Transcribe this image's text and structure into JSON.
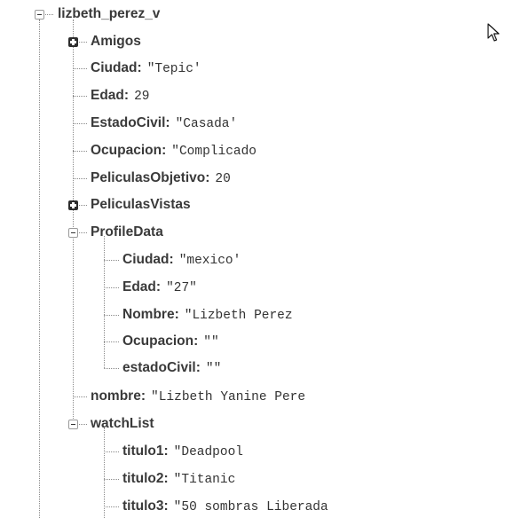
{
  "tree": {
    "root": {
      "key": "lizbeth_perez_v"
    },
    "amigos": {
      "key": "Amigos"
    },
    "ciudad": {
      "key": "Ciudad",
      "value": "\"Tepic'"
    },
    "edad": {
      "key": "Edad",
      "value": "29"
    },
    "estado_civil": {
      "key": "EstadoCivil",
      "value": "\"Casada'"
    },
    "ocupacion": {
      "key": "Ocupacion",
      "value": "\"Complicado"
    },
    "peliculas_objetivo": {
      "key": "PeliculasObjetivo",
      "value": "20"
    },
    "peliculas_vistas": {
      "key": "PeliculasVistas"
    },
    "profile_data": {
      "key": "ProfileData",
      "ciudad": {
        "key": "Ciudad",
        "value": "\"mexico'"
      },
      "edad": {
        "key": "Edad",
        "value": "\"27\""
      },
      "nombre": {
        "key": "Nombre",
        "value": "\"Lizbeth Perez"
      },
      "ocupacion": {
        "key": "Ocupacion",
        "value": "\"\""
      },
      "estado_civil": {
        "key": "estadoCivil",
        "value": "\"\""
      }
    },
    "nombre": {
      "key": "nombre",
      "value": "\"Lizbeth Yanine Pere"
    },
    "watch_list": {
      "key": "watchList",
      "titulo1": {
        "key": "titulo1",
        "value": "\"Deadpool"
      },
      "titulo2": {
        "key": "titulo2",
        "value": "\"Titanic"
      },
      "titulo3": {
        "key": "titulo3",
        "value": "\"50 sombras Liberada"
      }
    }
  },
  "icons": {
    "expand": "plus-box-icon",
    "collapse": "minus-box-icon",
    "pointer": "mouse-pointer-icon"
  }
}
